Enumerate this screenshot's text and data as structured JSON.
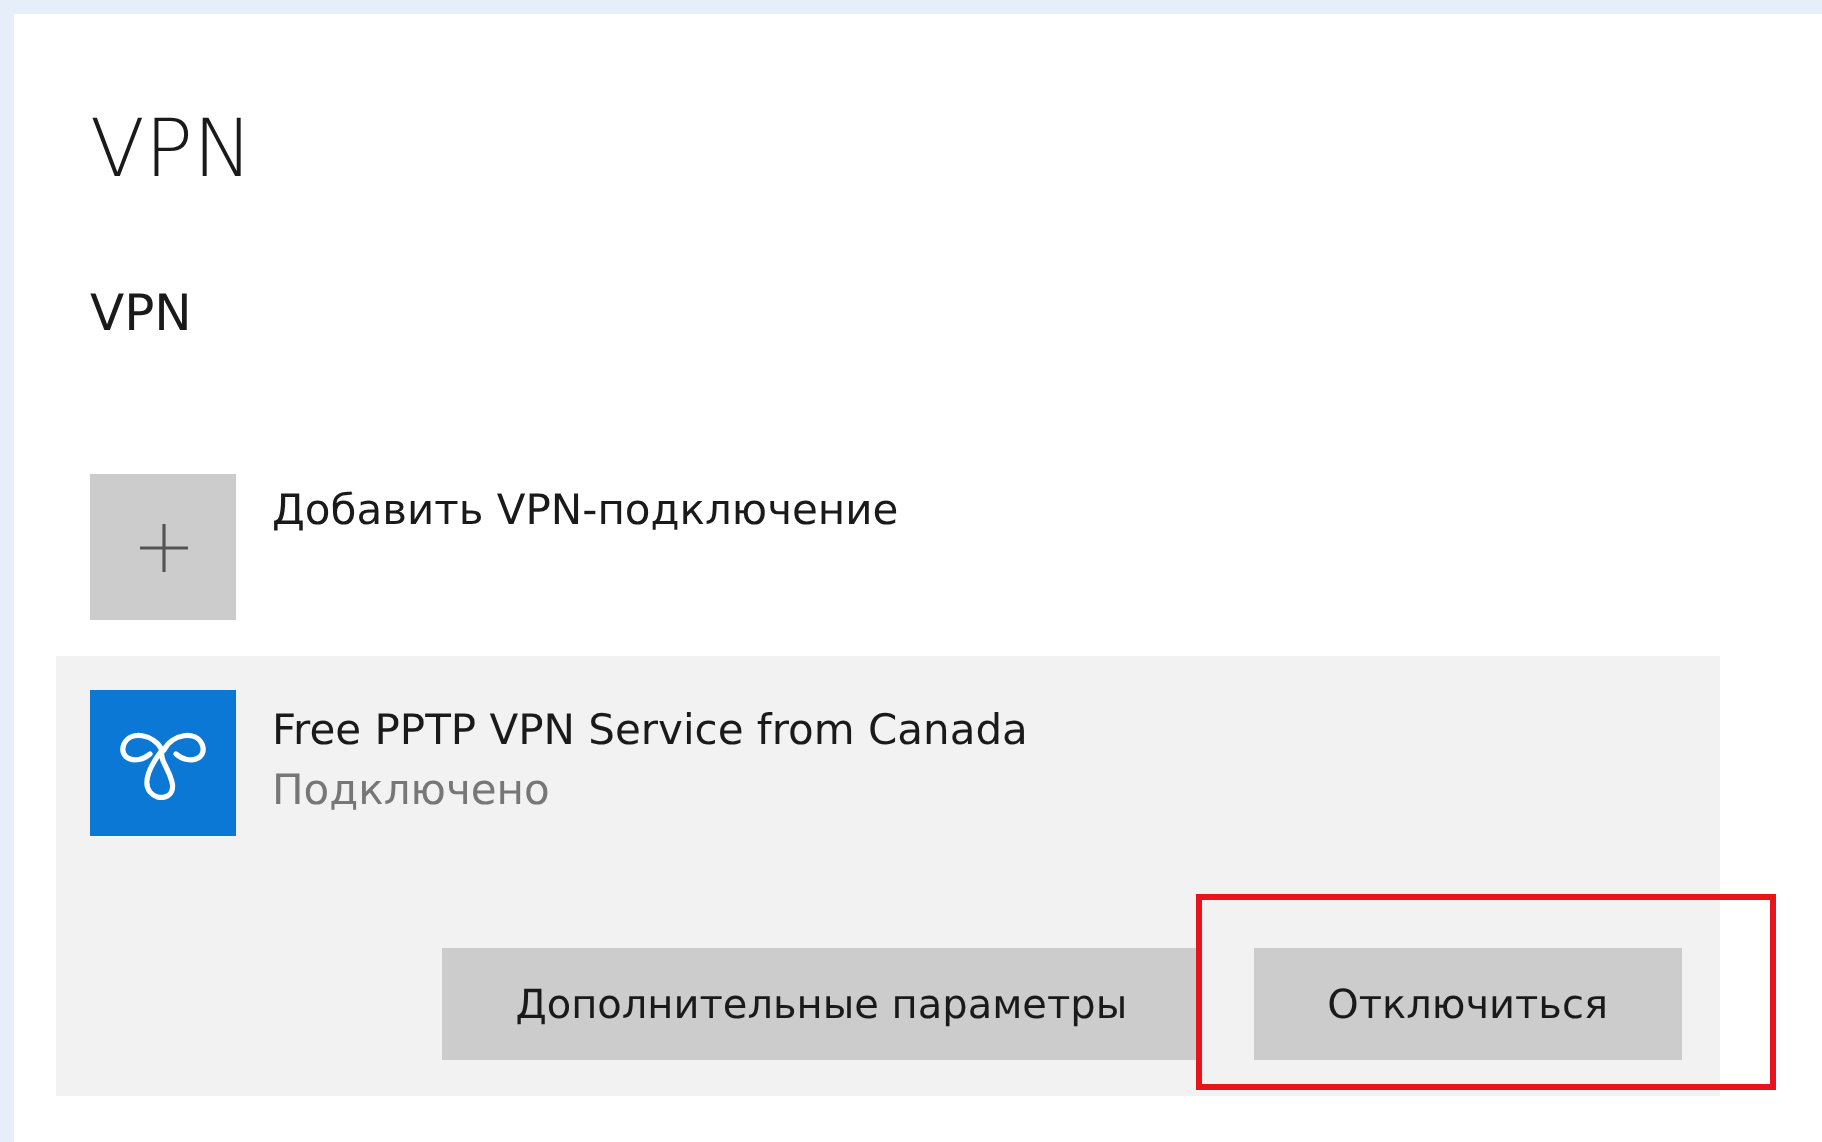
{
  "title": "VPN",
  "section": "VPN",
  "add_connection": {
    "label": "Добавить VPN-подключение"
  },
  "connections": [
    {
      "name": "Free PPTP VPN Service from Canada",
      "status": "Подключено",
      "expanded": true,
      "buttons": [
        {
          "label": "Дополнительные параметры",
          "highlighted": false
        },
        {
          "label": "Отключиться",
          "highlighted": true
        }
      ]
    }
  ]
}
